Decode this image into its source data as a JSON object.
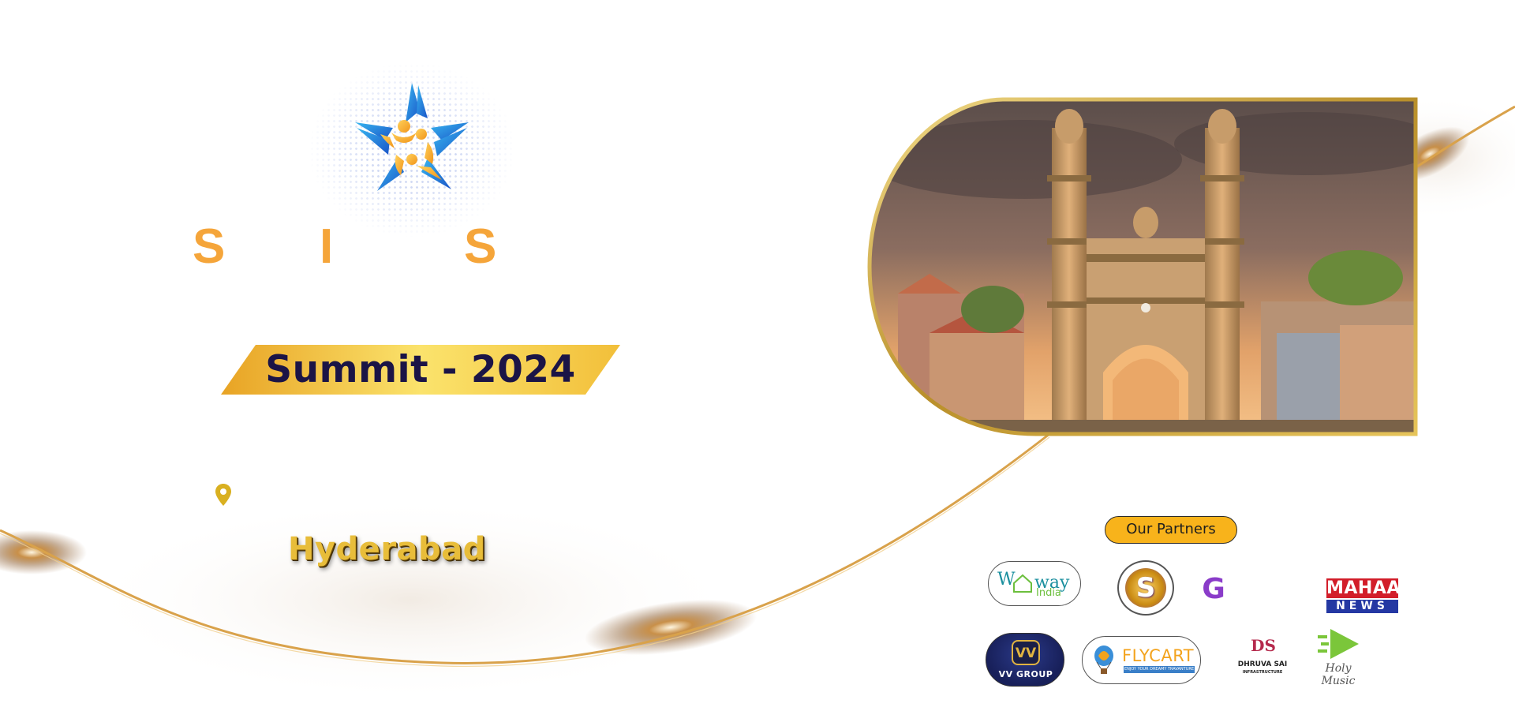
{
  "event": {
    "brand_letters": [
      "S",
      "I",
      "S"
    ],
    "title": "Summit - 2024",
    "city": "Hyderabad"
  },
  "icons": {
    "logo": "star-people-logo-icon",
    "location": "map-pin-icon"
  },
  "hero": {
    "image": "charminar-illustration",
    "frame_color": "#c9a33c"
  },
  "partners": {
    "heading": "Our Partners",
    "logos": [
      {
        "id": "wayindia",
        "text_top_left": "W",
        "text_top_right": "way",
        "text_sub": "India"
      },
      {
        "id": "s-brand",
        "text": "S"
      },
      {
        "id": "g-brand",
        "text": "G"
      },
      {
        "id": "mahaa-news",
        "line1": "MAHAA",
        "line2": "NEWS"
      },
      {
        "id": "vv-group",
        "mark": "VV",
        "text": "VV GROUP"
      },
      {
        "id": "flycart",
        "text": "FLYCART",
        "tagline": "ENJOY YOUR DREAMY TRAVANTURE"
      },
      {
        "id": "dhruva-sai",
        "mark": "DS",
        "text": "DHRUVA SAI",
        "sub": "INFRASTRUCTURE"
      },
      {
        "id": "holy-music",
        "text": "Holy Music"
      }
    ]
  },
  "colors": {
    "brand_orange": "#f5a53a",
    "banner_gold": "#f2c23b",
    "title_navy": "#1b1446",
    "city_gold": "#e8bd3a",
    "pill_yellow": "#f8b31b",
    "swoosh_gold": "#d9a24b"
  }
}
